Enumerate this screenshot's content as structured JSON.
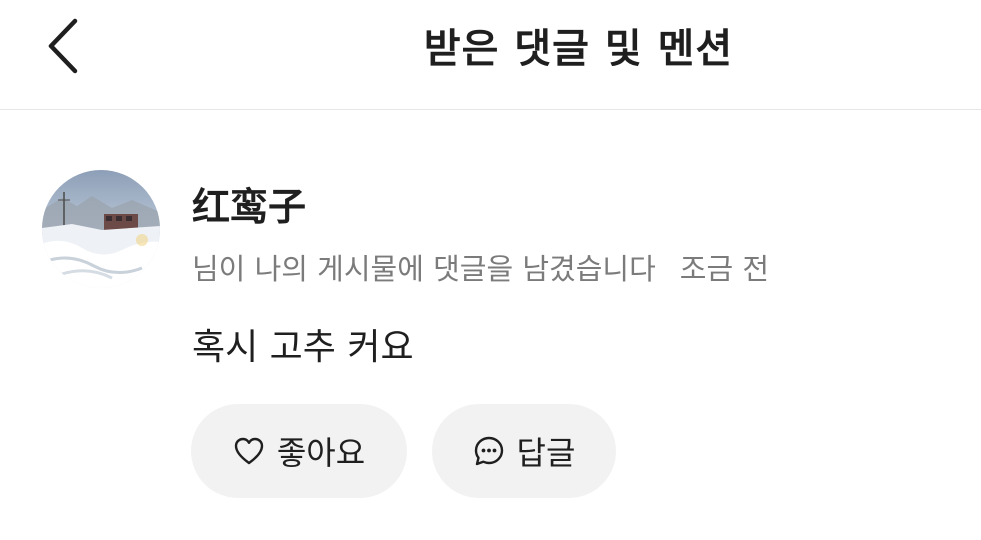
{
  "header": {
    "title": "받은 댓글 및 멘션",
    "back_icon": "chevron-left-icon"
  },
  "notification": {
    "username": "红鸾子",
    "message": "님이 나의 게시물에 댓글을 남겼습니다",
    "time": "조금 전",
    "comment": "혹시 고추 커요",
    "actions": {
      "like_label": "좋아요",
      "like_icon": "heart-icon",
      "reply_label": "답글",
      "reply_icon": "chat-bubble-icon"
    }
  },
  "colors": {
    "text_primary": "#1f1f1f",
    "text_secondary": "#7b7b7b",
    "pill_bg": "#f2f2f2",
    "divider": "#e6e6e6"
  }
}
